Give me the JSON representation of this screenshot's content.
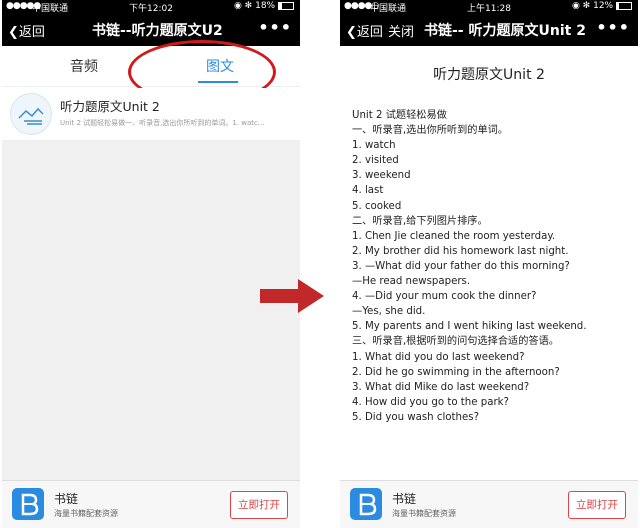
{
  "left_phone": {
    "status": {
      "signal": "●●●●●",
      "carrier": "中国联通",
      "wifi": "ᯤ",
      "time": "下午12:02",
      "extra": "◉ ✻",
      "battery": "18%",
      "battery_level": 0.18
    },
    "nav": {
      "back_label": "返回",
      "title": "书链--听力题原文U2",
      "more": "•••"
    },
    "tabs": [
      {
        "label": "音频"
      },
      {
        "label": "图文",
        "active": true
      }
    ],
    "item": {
      "title": "听力题原文Unit 2",
      "subtitle": "Unit 2 试题轻松易做一、听录音,选出你所听到的单词。1. watc..."
    }
  },
  "right_phone": {
    "status": {
      "signal": "●●●●○",
      "carrier": "中国联通",
      "wifi": "ᯤ",
      "time": "上午11:28",
      "extra": "◉ ✻",
      "battery": "12%",
      "battery_level": 0.12
    },
    "nav": {
      "back_label": "返回",
      "close_label": "关闭",
      "title": "书链-- 听力题原文Unit 2",
      "more": "•••"
    },
    "article": {
      "title": "听力题原文Unit 2",
      "lines": [
        "Unit 2 试题轻松易做",
        "一、听录音,选出你所听到的单词。",
        "1. watch",
        "2. visited",
        "3. weekend",
        "4. last",
        "5. cooked",
        "二、听录音,给下列图片排序。",
        "1. Chen Jie cleaned the room yesterday.",
        "2. My brother did his homework last night.",
        "3. —What did your father do this morning?",
        "    —He read newspapers.",
        "4. —Did your mum cook the dinner?",
        "    —Yes, she did.",
        "5. My parents and I went hiking last weekend.",
        "三、听录音,根据听到的问句选择合适的答语。",
        "1. What did you do last weekend?",
        "2. Did he go swimming in the afternoon?",
        "3. What did Mike do last weekend?",
        "4. How did you go to the park?",
        "5. Did you wash clothes?"
      ]
    }
  },
  "footer": {
    "app_name": "书链",
    "app_desc": "海量书籍配套资源",
    "open_label": "立即打开"
  },
  "colors": {
    "accent": "#2a8be0",
    "highlight_circle": "#d01a1a",
    "arrow": "#c0282a",
    "nav_bg": "#000000"
  }
}
